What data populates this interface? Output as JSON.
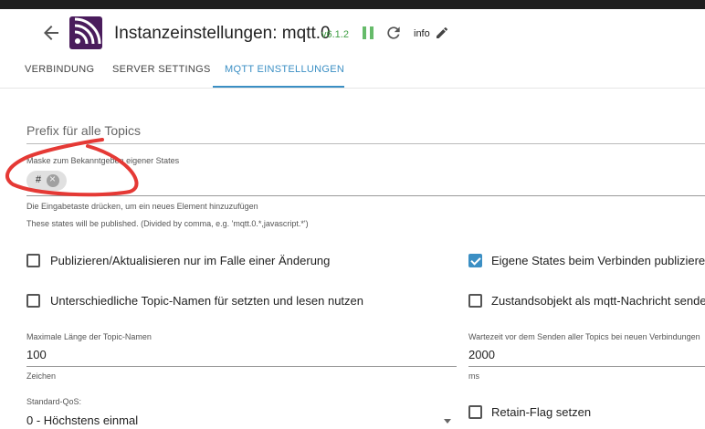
{
  "header": {
    "title": "Instanzeinstellungen: mqtt.0",
    "version": "v6.1.2",
    "info_label": "info",
    "icons": {
      "back": "arrow-left-icon",
      "logo": "mqtt-logo",
      "pause": "pause-icon",
      "reload": "reload-icon",
      "edit": "pencil-icon"
    },
    "colors": {
      "logo": "#4a1c5c",
      "version": "#43a047",
      "pause": "#66bb6a"
    }
  },
  "tabs": [
    {
      "label": "VERBINDUNG",
      "active": false
    },
    {
      "label": "SERVER SETTINGS",
      "active": false
    },
    {
      "label": "MQTT EINSTELLUNGEN",
      "active": true
    }
  ],
  "form": {
    "prefix_label": "Prefix für alle Topics",
    "mask": {
      "label": "Maske zum Bekanntgeben eigener States",
      "chips": [
        "#"
      ],
      "helper_enter": "Die Eingabetaste drücken, um ein neues Element hinzuzufügen",
      "helper_published": "These states will be published. (Divided by comma, e.g. 'mqtt.0.*,javascript.*')"
    },
    "checkboxes": {
      "publish_on_change": {
        "label": "Publizieren/Aktualisieren nur im Falle einer Änderung",
        "checked": false
      },
      "own_states_on_connect": {
        "label": "Eigene States beim Verbinden publizieren",
        "checked": true
      },
      "different_topic_names": {
        "label": "Unterschiedliche Topic-Namen für setzten und lesen nutzen",
        "checked": false
      },
      "state_object_as_message": {
        "label": "Zustandsobjekt als mqtt-Nachricht senden",
        "checked": false
      },
      "retain_flag": {
        "label": "Retain-Flag setzen",
        "checked": false
      }
    },
    "max_topic_length": {
      "label": "Maximale Länge der Topic-Namen",
      "value": "100",
      "helper": "Zeichen"
    },
    "wait_time": {
      "label": "Wartezeit vor dem Senden aller Topics bei neuen Verbindungen",
      "value": "2000",
      "helper": "ms"
    },
    "qos": {
      "label": "Standard-QoS:",
      "value": "0 - Höchstens einmal"
    }
  },
  "accent_color": "#3b8fc4",
  "annotation_color": "#e53935"
}
